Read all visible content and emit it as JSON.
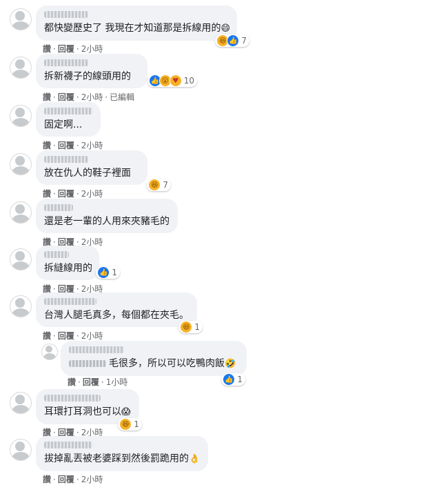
{
  "comments": [
    {
      "text": "都快變歷史了 我現在才知道那是拆線用的",
      "emoji": "😄",
      "reactions": {
        "icons": [
          "haha-icon",
          "like-icon"
        ],
        "count": "7"
      },
      "like": "讚",
      "reply": "回覆",
      "time": "2小時",
      "extra": ""
    },
    {
      "text": "拆新襪子的線頭用的",
      "emoji": "",
      "reactions": {
        "icons": [
          "like-icon",
          "wow-icon",
          "care-icon"
        ],
        "count": "10"
      },
      "like": "讚",
      "reply": "回覆",
      "time": "2小時",
      "extra": "已編輯"
    },
    {
      "text": "固定啊...",
      "emoji": "",
      "reactions": null,
      "like": "讚",
      "reply": "回覆",
      "time": "2小時",
      "extra": ""
    },
    {
      "text": "放在仇人的鞋子裡面",
      "emoji": "",
      "reactions": {
        "icons": [
          "haha-icon"
        ],
        "count": "7"
      },
      "like": "讚",
      "reply": "回覆",
      "time": "2小時",
      "extra": ""
    },
    {
      "text": "還是老一輩的人用來夾豬毛的",
      "emoji": "",
      "reactions": null,
      "like": "讚",
      "reply": "回覆",
      "time": "2小時",
      "extra": ""
    },
    {
      "text": "拆縫線用的",
      "emoji": "",
      "reactions": {
        "icons": [
          "like-icon"
        ],
        "count": "1"
      },
      "like": "讚",
      "reply": "回覆",
      "time": "2小時",
      "extra": ""
    },
    {
      "text": "台灣人腿毛真多，每個都在夾毛。",
      "emoji": "",
      "reactions": {
        "icons": [
          "haha-icon"
        ],
        "count": "1"
      },
      "like": "讚",
      "reply": "回覆",
      "time": "2小時",
      "extra": ""
    }
  ],
  "reply": {
    "text": "毛很多，所以可以吃鴨肉飯",
    "emoji": "🤣",
    "reactions": {
      "icons": [
        "like-icon"
      ],
      "count": "1"
    },
    "like": "讚",
    "reply": "回覆",
    "time": "1小時"
  },
  "comments2": [
    {
      "text": "耳環打耳洞也可以",
      "emoji": "😱",
      "reactions": {
        "icons": [
          "haha-icon"
        ],
        "count": "1"
      },
      "like": "讚",
      "reply": "回覆",
      "time": "2小時",
      "extra": ""
    },
    {
      "text": "拔掉亂丟被老婆踩到然後罰跪用的",
      "emoji": "👌",
      "reactions": null,
      "like": "讚",
      "reply": "回覆",
      "time": "2小時",
      "extra": ""
    }
  ],
  "colors": {
    "bubble": "#f0f2f5",
    "text": "#1c1e21",
    "meta": "#65676b",
    "like_blue": "#1877f2",
    "haha_yellow": "#f7b125"
  }
}
